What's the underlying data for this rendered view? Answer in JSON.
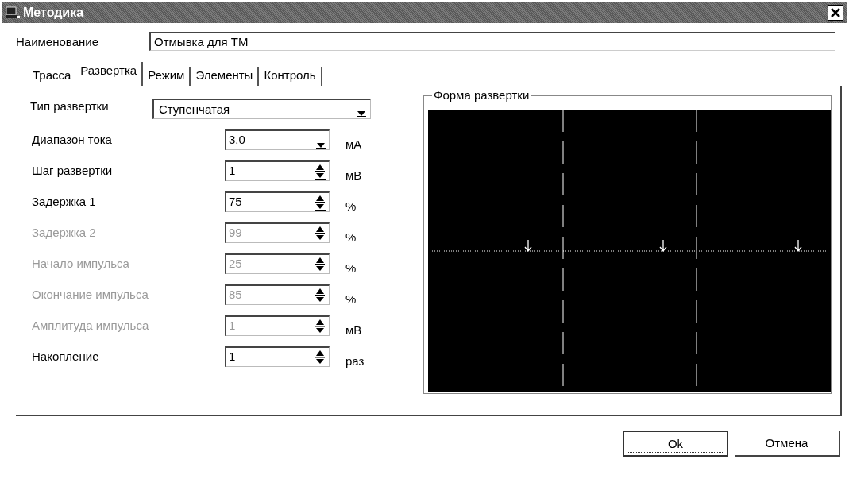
{
  "window": {
    "title": "Методика"
  },
  "name_field": {
    "label": "Наименование",
    "value": "Отмывка для ТМ"
  },
  "tabs": [
    {
      "label": "Трасса",
      "selected": false
    },
    {
      "label": "Развертка",
      "selected": true
    },
    {
      "label": "Режим",
      "selected": false
    },
    {
      "label": "Элементы",
      "selected": false
    },
    {
      "label": "Контроль",
      "selected": false
    }
  ],
  "sweep_type": {
    "label": "Тип развертки",
    "value": "Ступенчатая"
  },
  "params": [
    {
      "kind": "combo",
      "label": "Диапазон тока",
      "value": "3.0",
      "unit": "мА",
      "disabled": false
    },
    {
      "kind": "spin",
      "label": "Шаг развертки",
      "value": "1",
      "unit": "мВ",
      "disabled": false
    },
    {
      "kind": "spin",
      "label": "Задержка 1",
      "value": "75",
      "unit": "%",
      "disabled": false
    },
    {
      "kind": "spin",
      "label": "Задержка 2",
      "value": "99",
      "unit": "%",
      "disabled": true
    },
    {
      "kind": "spin",
      "label": "Начало импульса",
      "value": "25",
      "unit": "%",
      "disabled": true
    },
    {
      "kind": "spin",
      "label": "Окончание импульса",
      "value": "85",
      "unit": "%",
      "disabled": true
    },
    {
      "kind": "spin",
      "label": "Амплитуда импульса",
      "value": "1",
      "unit": "мВ",
      "disabled": true
    },
    {
      "kind": "spin",
      "label": "Накопление",
      "value": "1",
      "unit": "раз",
      "disabled": false
    }
  ],
  "sweep_shape": {
    "title": "Форма развертки"
  },
  "buttons": [
    {
      "label": "Ok",
      "default": true
    },
    {
      "label": "Отмена",
      "default": false
    }
  ]
}
